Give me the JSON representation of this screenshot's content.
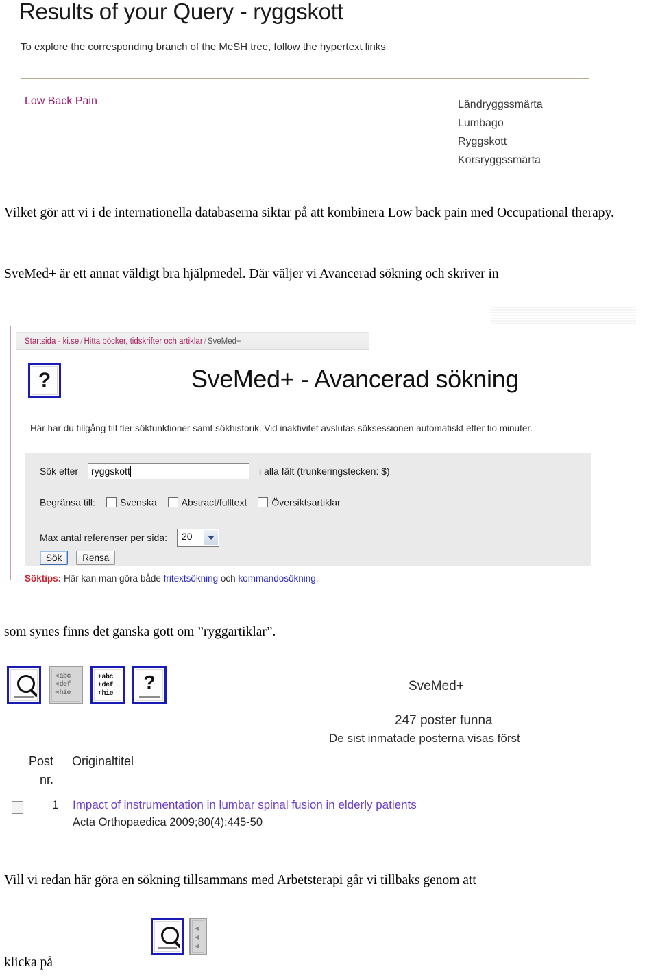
{
  "mesh_result": {
    "title": "Results of your Query - ryggskott",
    "subtitle": "To explore the corresponding branch of the MeSH tree, follow the hypertext links",
    "english_term": "Low Back Pain",
    "swedish_terms": [
      "Ländryggssmärta",
      "Lumbago",
      "Ryggskott",
      "Korsryggssmärta"
    ],
    "link_color": "#99186c"
  },
  "prose": {
    "para1": "Vilket gör att vi i de internationella databaserna siktar på att kombinera Low back pain med Occupational therapy.",
    "para2": "SveMed+ är ett annat väldigt bra hjälpmedel. Där väljer vi Avancerad sökning och skriver in",
    "para3": "som synes finns det ganska gott om ”ryggartiklar”.",
    "para4": "Vill vi redan här göra en sökning tillsammans med Arbetsterapi går vi tillbaks genom att",
    "para5": "klicka på"
  },
  "svemed_shot": {
    "breadcrumb": {
      "crumb1": "Startsida - ki.se",
      "sep1": "/",
      "crumb2": "Hitta böcker, tidskrifter och artiklar",
      "sep2": "/",
      "crumb3": "SveMed+"
    },
    "help_icon_glyph": "?",
    "heading": "SveMed+ - Avancerad sökning",
    "intro": "Här har du tillgång till fler sökfunktioner samt sökhistorik. Vid inaktivitet avslutas söksessionen automatiskt efter tio minuter.",
    "form": {
      "search_label": "Sök efter",
      "search_value": "ryggskott",
      "search_hint": "i alla fält (trunkeringstecken: $)",
      "limit_label": "Begränsa till:",
      "checkboxes": [
        {
          "label": "Svenska",
          "checked": false
        },
        {
          "label": "Abstract/fulltext",
          "checked": false
        },
        {
          "label": "Översiktsartiklar",
          "checked": false
        }
      ],
      "max_label": "Max antal referenser per sida:",
      "max_value": "20",
      "max_options": [
        "20"
      ],
      "search_button": "Sök",
      "clear_button": "Rensa"
    },
    "tips": {
      "label": "Söktips:",
      "text_before": " Här kan man göra både ",
      "link1": "fritextsökning",
      "text_middle": " och ",
      "link2": "kommandosökning",
      "text_after": ".",
      "label_color": "#d0202a",
      "link_color": "#2a2ad0"
    }
  },
  "results_shot": {
    "toolbar_icons": [
      {
        "name": "magnifier-icon",
        "state": "enabled"
      },
      {
        "name": "alpha-list-back-icon",
        "state": "disabled"
      },
      {
        "name": "alpha-list-updown-icon",
        "state": "enabled"
      },
      {
        "name": "help-question-icon",
        "state": "enabled"
      }
    ],
    "icon_rows": [
      "abc",
      "def",
      "hie"
    ],
    "database_label": "SveMed+",
    "hits_count": "247 poster funna",
    "hits_note": "De sist inmatade posterna visas först",
    "columns": {
      "post": "Post",
      "nr": "nr.",
      "title": "Originaltitel"
    },
    "rows": [
      {
        "num": "1",
        "title": "Impact of instrumentation in lumbar spinal fusion in elderly patients",
        "source": "Acta Orthopaedica 2009;80(4):445-50",
        "checked": false
      }
    ],
    "title_link_color": "#6a3ccb"
  },
  "bottom_icons": [
    {
      "name": "magnifier-icon",
      "state": "enabled"
    },
    {
      "name": "alpha-list-back-icon",
      "state": "disabled"
    }
  ]
}
